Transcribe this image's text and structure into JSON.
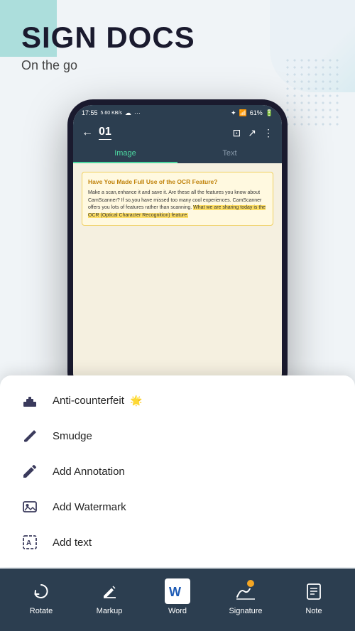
{
  "header": {
    "title": "SIGN DOCS",
    "subtitle": "On the go"
  },
  "phone": {
    "status_bar": {
      "time": "17:55",
      "data": "5.60 KB/s",
      "battery": "61%"
    },
    "toolbar": {
      "page": "01"
    },
    "tabs": [
      {
        "label": "Image",
        "active": true
      },
      {
        "label": "Text",
        "active": false
      }
    ],
    "document": {
      "title": "Have You Made Full Use of the OCR Feature?",
      "body": "Make a scan,enhance it and save it. Are these all the features you know about CamScanner? If so,you have missed too many cool experiences. CamScanner offers you lots of features rather than scanning. What we are sharing today is the OCR (Optical Character Recognition) feature."
    }
  },
  "menu": {
    "items": [
      {
        "id": "anti-counterfeit",
        "label": "Anti-counterfeit",
        "emoji": "🌟",
        "icon": "stamp"
      },
      {
        "id": "smudge",
        "label": "Smudge",
        "emoji": "",
        "icon": "eraser"
      },
      {
        "id": "add-annotation",
        "label": "Add Annotation",
        "emoji": "",
        "icon": "pencil"
      },
      {
        "id": "add-watermark",
        "label": "Add Watermark",
        "emoji": "",
        "icon": "image"
      },
      {
        "id": "add-text",
        "label": "Add text",
        "emoji": "",
        "icon": "text"
      }
    ]
  },
  "bottom_nav": {
    "items": [
      {
        "id": "rotate",
        "label": "Rotate"
      },
      {
        "id": "markup",
        "label": "Markup"
      },
      {
        "id": "word",
        "label": "Word"
      },
      {
        "id": "signature",
        "label": "Signature",
        "has_badge": true
      },
      {
        "id": "note",
        "label": "Note"
      }
    ]
  }
}
